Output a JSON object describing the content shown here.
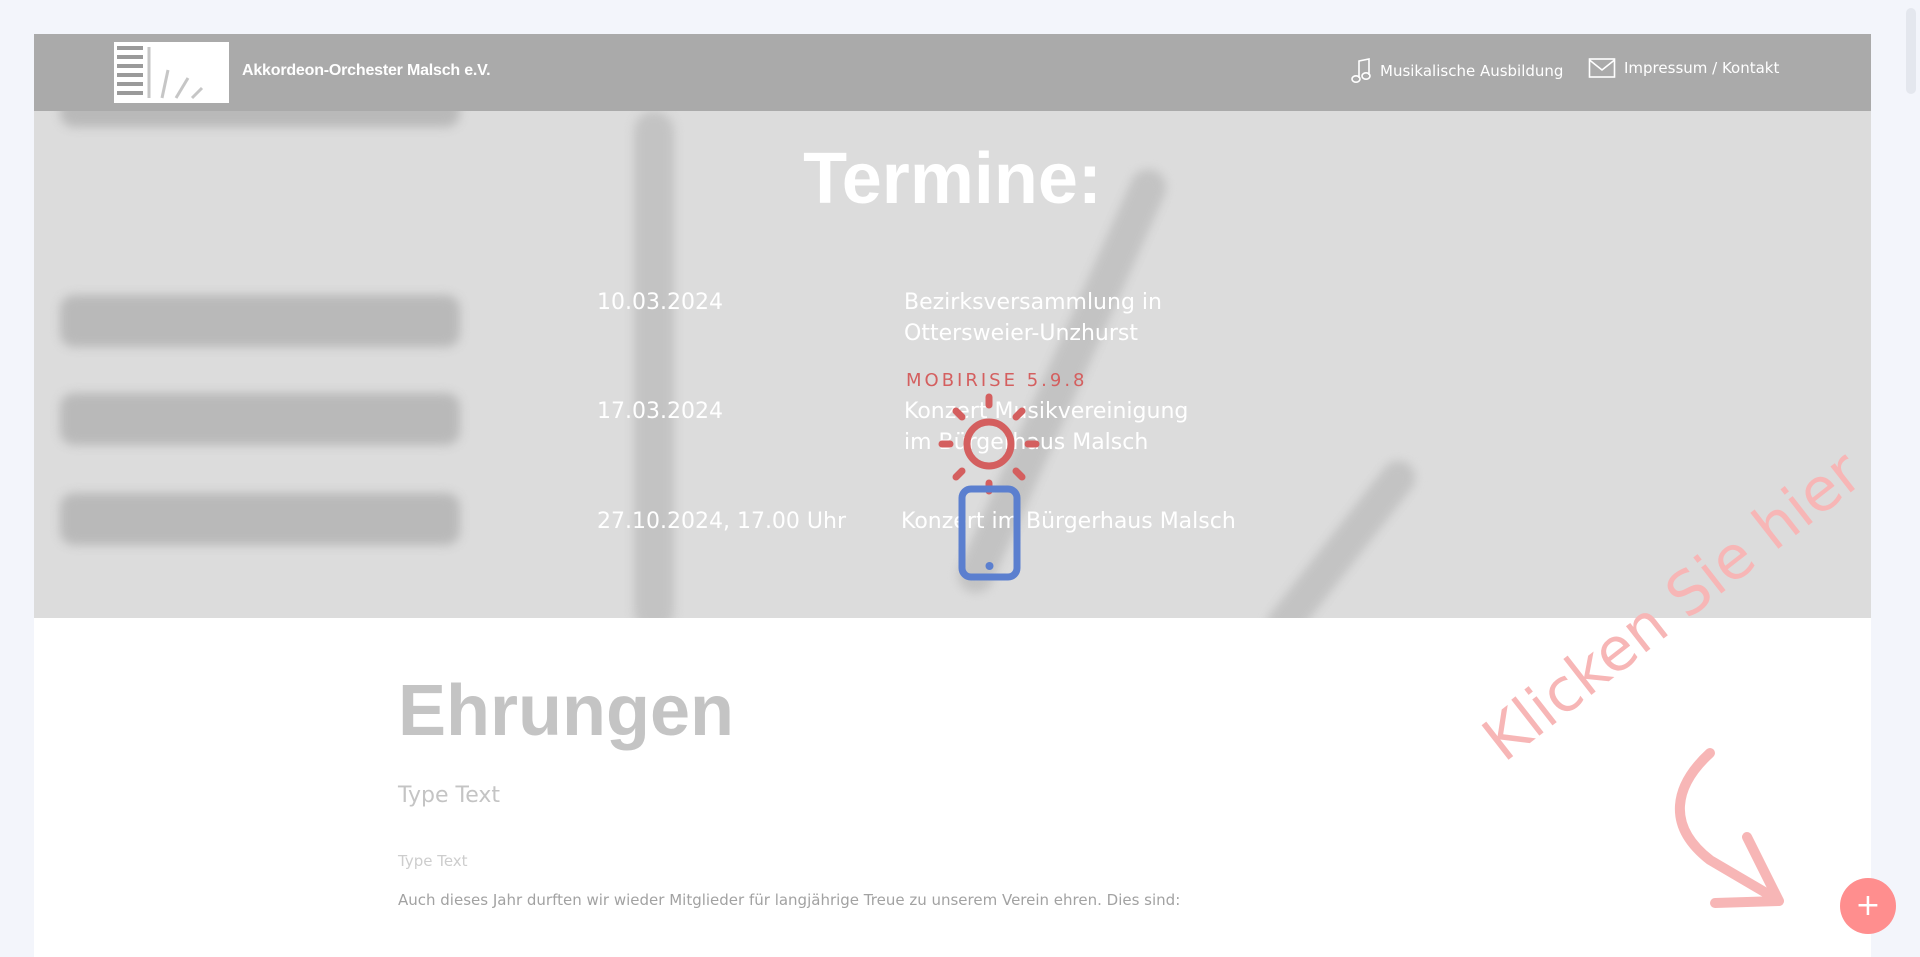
{
  "navbar": {
    "brand": "Akkordeon-Orchester Malsch e.V.",
    "links": [
      {
        "label": "Musikalische Ausbildung",
        "icon": "music-note-icon"
      },
      {
        "label": "Impressum / Kontakt",
        "icon": "envelope-icon"
      }
    ]
  },
  "hero": {
    "title": "Termine:",
    "events": [
      {
        "date": "10.03.2024",
        "description": "Bezirksversammlung in Ottersweier-Unzhurst"
      },
      {
        "date": "17.03.2024",
        "description": "Konzert Musikvereinigung im Bürgerhaus Malsch"
      },
      {
        "date": "27.10.2024, 17.00 Uhr",
        "description": "Konzert im Bürgerhaus Malsch"
      }
    ]
  },
  "watermark": {
    "label": "MOBIRISE  5.9.8",
    "sun_color": "#d45f5f",
    "phone_color": "#5b7fcf"
  },
  "section": {
    "title": "Ehrungen",
    "subtitle": "Type Text",
    "small_text": "Type Text",
    "paragraph": "Auch dieses Jahr durften wir wieder Mitglieder für langjährige Treue zu unserem Verein ehren. Dies sind:"
  },
  "overlay": {
    "click_hint": "Klicken Sie hier",
    "add_button": "+",
    "accent_color": "#ff8e8e"
  }
}
